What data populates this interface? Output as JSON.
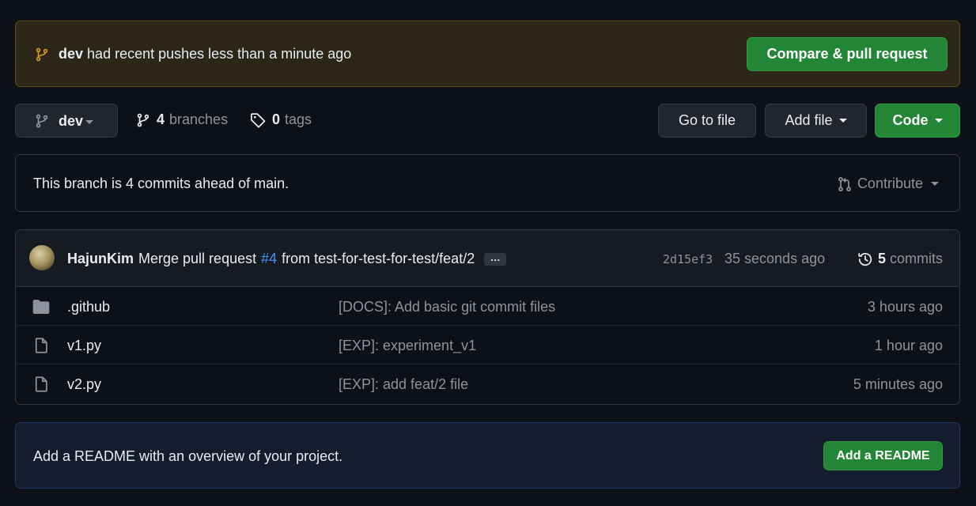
{
  "banner": {
    "branch": "dev",
    "message": "had recent pushes less than a minute ago",
    "compare_label": "Compare & pull request"
  },
  "toolbar": {
    "branch": "dev",
    "branches_count": "4",
    "branches_label": "branches",
    "tags_count": "0",
    "tags_label": "tags",
    "goto_label": "Go to file",
    "addfile_label": "Add file",
    "code_label": "Code"
  },
  "ahead": {
    "text": "This branch is 4 commits ahead of main.",
    "contribute_label": "Contribute"
  },
  "latest_commit": {
    "author": "HajunKim",
    "message_prefix": "Merge pull request",
    "pr_link": "#4",
    "message_suffix": "from test-for-test-for-test/feat/2",
    "ellipsis": "…",
    "sha": "2d15ef3",
    "time": "35 seconds ago",
    "commits_count": "5",
    "commits_label": "commits"
  },
  "files": [
    {
      "name": ".github",
      "type": "folder",
      "message": "[DOCS]: Add basic git commit files",
      "time": "3 hours ago"
    },
    {
      "name": "v1.py",
      "type": "file",
      "message": "[EXP]: experiment_v1",
      "time": "1 hour ago"
    },
    {
      "name": "v2.py",
      "type": "file",
      "message": "[EXP]: add feat/2 file",
      "time": "5 minutes ago"
    }
  ],
  "readme": {
    "text": "Add a README with an overview of your project.",
    "button_label": "Add a README"
  },
  "colors": {
    "background": "#0d1117",
    "accent_green": "#238636",
    "link_blue": "#4493f8",
    "banner_bg": "#2b2617",
    "muted_text": "#8b949e"
  },
  "icons": {
    "banner": "git-branch-icon",
    "branches": "git-branch-icon",
    "tags": "tag-icon",
    "contribute": "git-pull-request-icon",
    "commits": "history-icon",
    "folder": "folder-icon",
    "file": "file-icon"
  }
}
